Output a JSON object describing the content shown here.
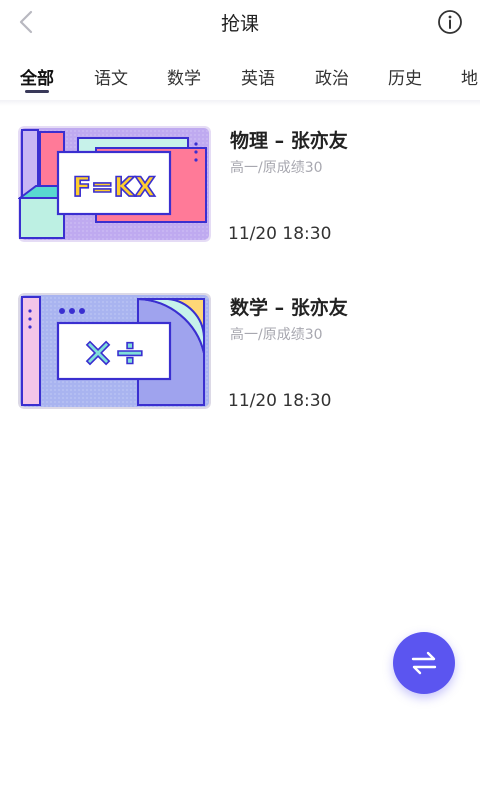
{
  "header": {
    "title": "抢课"
  },
  "tabs": [
    {
      "label": "全部"
    },
    {
      "label": "语文"
    },
    {
      "label": "数学"
    },
    {
      "label": "英语"
    },
    {
      "label": "政治"
    },
    {
      "label": "历史"
    },
    {
      "label": "地"
    }
  ],
  "courses": [
    {
      "title": "物理 – 张亦友",
      "subtitle": "高一/原成绩30",
      "time": "11/20  18:30",
      "thumb_text": "F=KX"
    },
    {
      "title": "数学 – 张亦友",
      "subtitle": "高一/原成绩30",
      "time": "11/20  18:30",
      "thumb_text": "×÷"
    }
  ],
  "icons": {
    "back": "chevron-left-icon",
    "info": "info-icon",
    "fab": "swap-arrows-icon"
  },
  "colors": {
    "accent": "#5b55f0",
    "tab_underline": "#3a3a5a"
  }
}
